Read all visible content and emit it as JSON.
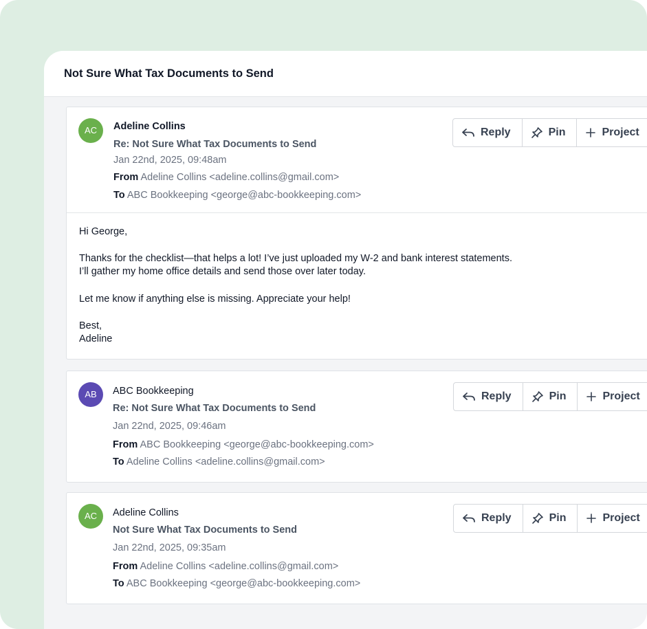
{
  "thread": {
    "title": "Not Sure What Tax Documents to Send"
  },
  "labels": {
    "from": "From",
    "to": "To"
  },
  "actions": {
    "reply": "Reply",
    "pin": "Pin",
    "project": "Project"
  },
  "colors": {
    "avatar_green": "#6ab04c",
    "avatar_purple": "#5b4ab3",
    "background": "#deeee3"
  },
  "messages": [
    {
      "initials": "AC",
      "sender": "Adeline Collins",
      "subject": "Re: Not Sure What Tax Documents to Send",
      "date": "Jan 22nd, 2025, 09:48am",
      "from": "Adeline Collins <adeline.collins@gmail.com>",
      "to": "ABC Bookkeeping <george@abc-bookkeeping.com>",
      "body": [
        "Hi George,",
        "Thanks for the checklist—that helps a lot! I’ve just uploaded my W-2 and bank interest statements.",
        "I’ll gather my home office details and send those over later today.",
        "Let me know if anything else is missing. Appreciate your help!",
        "Best,",
        "Adeline"
      ]
    },
    {
      "initials": "AB",
      "sender": "ABC Bookkeeping",
      "subject": "Re: Not Sure What Tax Documents to Send",
      "date": "Jan 22nd, 2025, 09:46am",
      "from": "ABC Bookkeeping <george@abc-bookkeeping.com>",
      "to": "Adeline Collins <adeline.collins@gmail.com>"
    },
    {
      "initials": "AC",
      "sender": "Adeline Collins",
      "subject": "Not Sure What Tax Documents to Send",
      "date": "Jan 22nd, 2025, 09:35am",
      "from": "Adeline Collins <adeline.collins@gmail.com>",
      "to": "ABC Bookkeeping <george@abc-bookkeeping.com>"
    }
  ]
}
